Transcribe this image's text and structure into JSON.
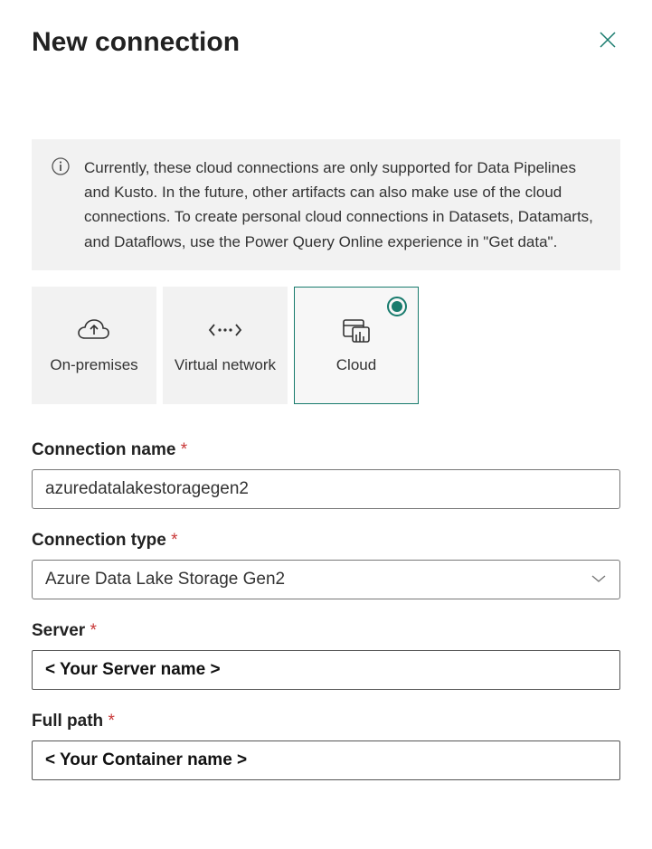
{
  "dialog": {
    "title": "New connection"
  },
  "info": {
    "text": "Currently, these cloud connections are only supported for Data Pipelines and Kusto. In the future, other artifacts can also make use of the cloud connections. To create personal cloud connections in Datasets, Datamarts, and Dataflows, use the Power Query Online experience in \"Get data\"."
  },
  "tabs": {
    "onprem": "On-premises",
    "vnet": "Virtual network",
    "cloud": "Cloud"
  },
  "form": {
    "connection_name_label": "Connection name",
    "connection_name_value": "azuredatalakestoragegen2",
    "connection_type_label": "Connection type",
    "connection_type_value": "Azure Data Lake Storage Gen2",
    "server_label": "Server",
    "server_value": "< Your Server name >",
    "full_path_label": "Full path",
    "full_path_value": "< Your Container name >"
  }
}
